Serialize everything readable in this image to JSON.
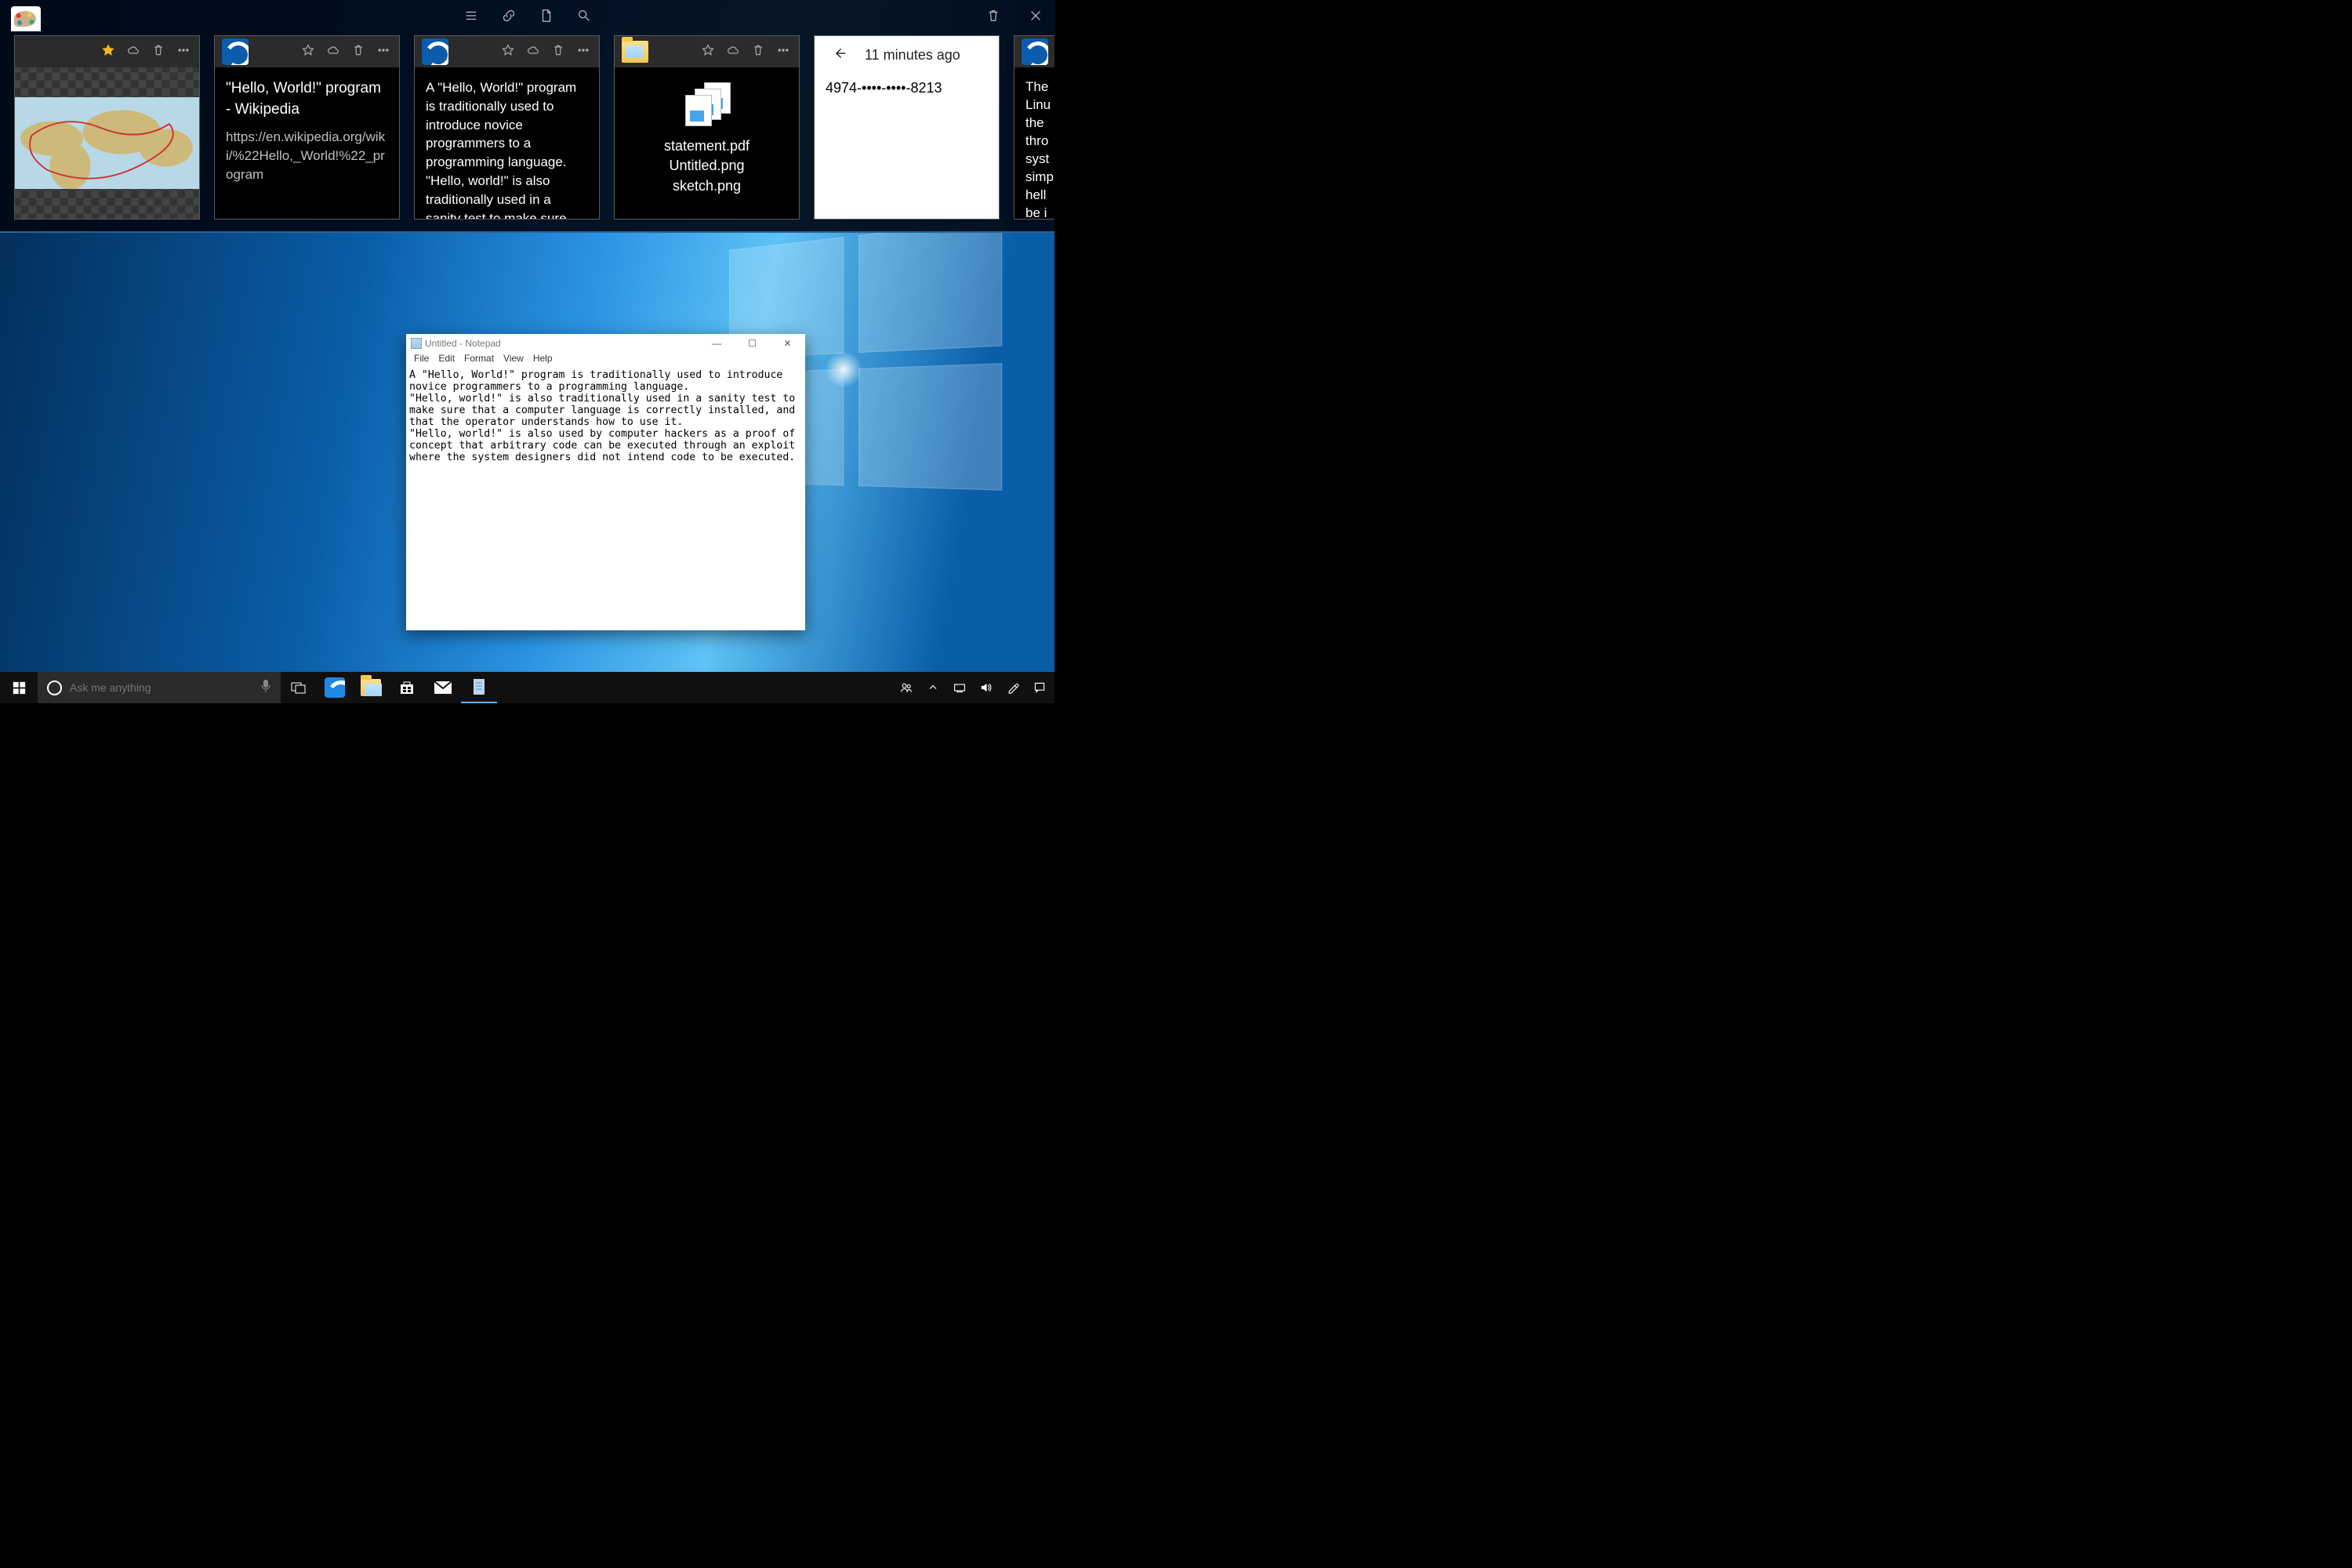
{
  "activities": {
    "cards": [
      {
        "type": "thumb"
      },
      {
        "type": "edge-link",
        "title": "\"Hello, World!\" program - Wikipedia",
        "url": "https://en.wikipedia.org/wiki/%22Hello,_World!%22_program"
      },
      {
        "type": "edge-text",
        "text": "A \"Hello, World!\" program is traditionally used to introduce novice programmers to a programming language. \"Hello, world!\" is also traditionally used in a sanity test to make sure"
      },
      {
        "type": "files",
        "file1": "statement.pdf",
        "file2": "Untitled.png",
        "file3": "sketch.png"
      },
      {
        "type": "history",
        "time": "11 minutes ago",
        "text": "4974-••••-••••-8213"
      },
      {
        "type": "edge-text-partial",
        "text": "The\nLinu\nthe\nthro\nsyst\nsimp\nhell\nbe i"
      }
    ]
  },
  "notepad": {
    "title": "Untitled - Notepad",
    "menu": [
      "File",
      "Edit",
      "Format",
      "View",
      "Help"
    ],
    "content": "A \"Hello, World!\" program is traditionally used to introduce novice programmers to a programming language.\n\"Hello, world!\" is also traditionally used in a sanity test to make sure that a computer language is correctly installed, and that the operator understands how to use it.\n\"Hello, world!\" is also used by computer hackers as a proof of concept that arbitrary code can be executed through an exploit where the system designers did not intend code to be executed."
  },
  "taskbar": {
    "search_placeholder": "Ask me anything"
  }
}
